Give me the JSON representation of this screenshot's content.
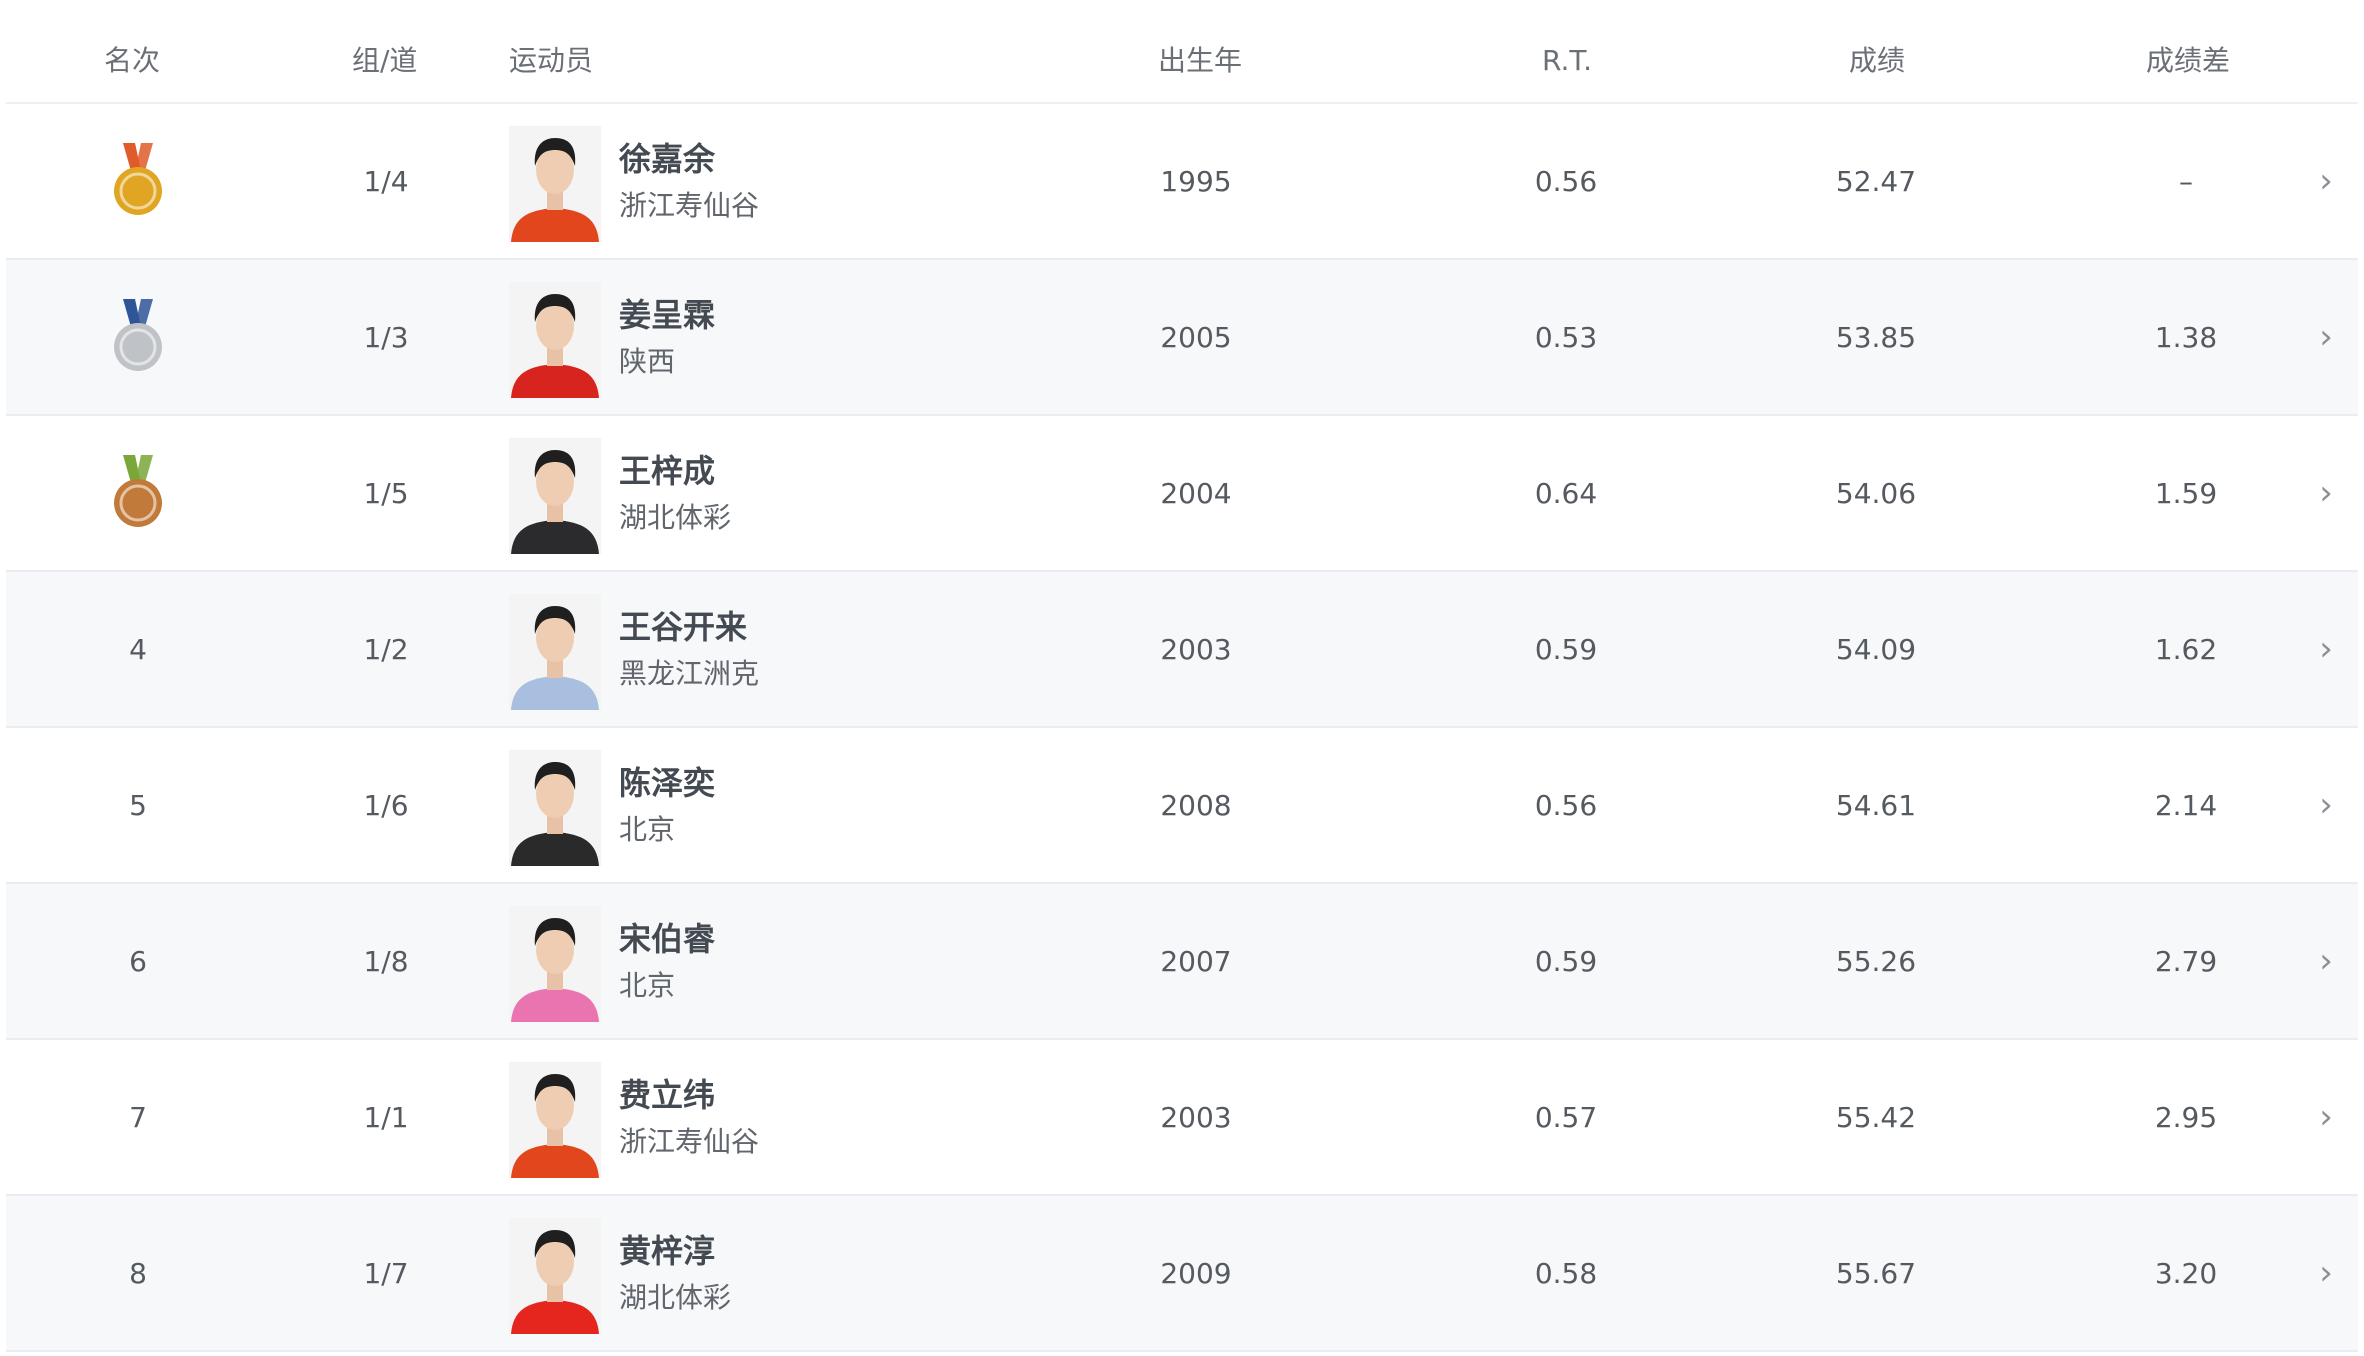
{
  "headers": {
    "rank": "名次",
    "lane": "组/道",
    "athlete": "运动员",
    "birth_year": "出生年",
    "rt": "R.T.",
    "time": "成绩",
    "diff": "成绩差"
  },
  "colors": {
    "gold": "#e0a623",
    "silver": "#bfc3c8",
    "bronze": "#c27a3a",
    "row_alt_bg": "#f7f8fa",
    "divider": "#e9ecf0"
  },
  "rows": [
    {
      "rank": "1",
      "medal": "gold-medal-icon",
      "lane": "1/4",
      "name": "徐嘉余",
      "team": "浙江寿仙谷",
      "birth_year": "1995",
      "rt": "0.56",
      "time": "52.47",
      "diff": "–",
      "shirt": "#e2461d"
    },
    {
      "rank": "2",
      "medal": "silver-medal-icon",
      "lane": "1/3",
      "name": "姜呈霖",
      "team": "陕西",
      "birth_year": "2005",
      "rt": "0.53",
      "time": "53.85",
      "diff": "1.38",
      "shirt": "#d8241f"
    },
    {
      "rank": "3",
      "medal": "bronze-medal-icon",
      "lane": "1/5",
      "name": "王梓成",
      "team": "湖北体彩",
      "birth_year": "2004",
      "rt": "0.64",
      "time": "54.06",
      "diff": "1.59",
      "shirt": "#2b2b2d"
    },
    {
      "rank": "4",
      "medal": "",
      "lane": "1/2",
      "name": "王谷开来",
      "team": "黑龙江洲克",
      "birth_year": "2003",
      "rt": "0.59",
      "time": "54.09",
      "diff": "1.62",
      "shirt": "#a9bfe0"
    },
    {
      "rank": "5",
      "medal": "",
      "lane": "1/6",
      "name": "陈泽奕",
      "team": "北京",
      "birth_year": "2008",
      "rt": "0.56",
      "time": "54.61",
      "diff": "2.14",
      "shirt": "#2a2a2a"
    },
    {
      "rank": "6",
      "medal": "",
      "lane": "1/8",
      "name": "宋伯睿",
      "team": "北京",
      "birth_year": "2007",
      "rt": "0.59",
      "time": "55.26",
      "diff": "2.79",
      "shirt": "#ea74b0"
    },
    {
      "rank": "7",
      "medal": "",
      "lane": "1/1",
      "name": "费立纬",
      "team": "浙江寿仙谷",
      "birth_year": "2003",
      "rt": "0.57",
      "time": "55.42",
      "diff": "2.95",
      "shirt": "#e2461d"
    },
    {
      "rank": "8",
      "medal": "",
      "lane": "1/7",
      "name": "黄梓淳",
      "team": "湖北体彩",
      "birth_year": "2009",
      "rt": "0.58",
      "time": "55.67",
      "diff": "3.20",
      "shirt": "#e5261f"
    }
  ],
  "arrow_glyph": "›"
}
